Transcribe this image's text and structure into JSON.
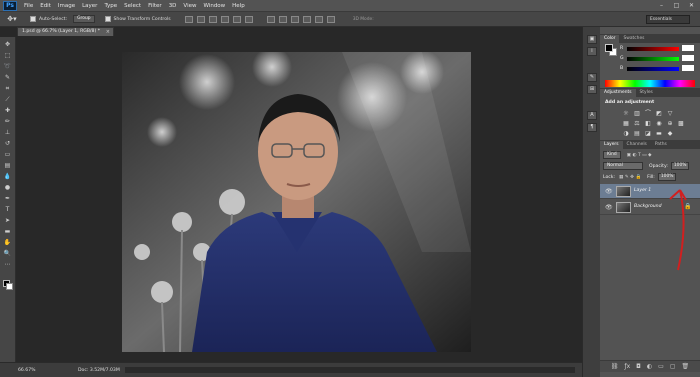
{
  "app": {
    "logo": "Ps"
  },
  "menu": [
    "File",
    "Edit",
    "Image",
    "Layer",
    "Type",
    "Select",
    "Filter",
    "3D",
    "View",
    "Window",
    "Help"
  ],
  "window_controls": [
    "–",
    "□",
    "✕"
  ],
  "options": {
    "tool_icon": "move-tool-icon",
    "auto_select_label": "Auto-Select:",
    "auto_select_value": "Group",
    "show_transform_label": "Show Transform Controls",
    "mode_3d_label": "3D Mode:",
    "workspace": "Essentials"
  },
  "document": {
    "tab_title": "1.psd @ 66.7% (Layer 1, RGB/8) *"
  },
  "status": {
    "zoom": "66.67%",
    "doc_info": "Doc: 3.52M/7.03M"
  },
  "panels": {
    "color_tabs": [
      "Color",
      "Swatches"
    ],
    "color_sliders": [
      {
        "label": "R",
        "value": "",
        "color": "#ff0000"
      },
      {
        "label": "G",
        "value": "",
        "color": "#00ff00"
      },
      {
        "label": "B",
        "value": "",
        "color": "#0000ff"
      }
    ],
    "adj_tabs": [
      "Adjustments",
      "Styles"
    ],
    "adj_title": "Add an adjustment",
    "layers_tabs": [
      "Layers",
      "Channels",
      "Paths"
    ],
    "kind_label": "Kind",
    "blend_mode": "Normal",
    "opacity_label": "Opacity:",
    "opacity_value": "100%",
    "lock_label": "Lock:",
    "fill_label": "Fill:",
    "fill_value": "100%",
    "layers": [
      {
        "name": "Layer 1",
        "selected": true
      },
      {
        "name": "Background",
        "selected": false
      }
    ]
  },
  "colors": {
    "accent_selected": "#6c7d93",
    "annotation": "#d11f1f"
  }
}
